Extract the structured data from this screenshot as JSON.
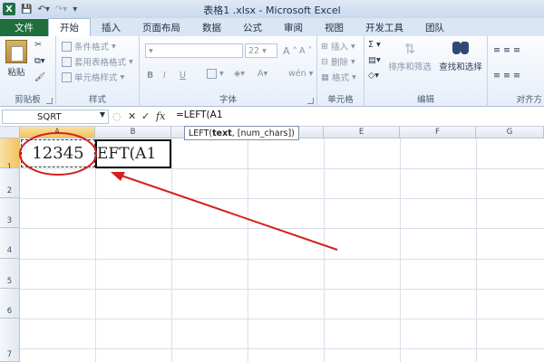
{
  "window": {
    "title": "表格1 .xlsx - Microsoft Excel",
    "app_icon": "X"
  },
  "tabs": [
    "文件",
    "开始",
    "插入",
    "页面布局",
    "数据",
    "公式",
    "审阅",
    "视图",
    "开发工具",
    "团队"
  ],
  "ribbon": {
    "clipboard": {
      "paste": "粘贴",
      "label": "剪贴板"
    },
    "styles": {
      "cond_format": "条件格式",
      "table_format": "套用表格格式",
      "cell_styles": "单元格样式",
      "label": "样式"
    },
    "font": {
      "size": "22",
      "bold": "B",
      "italic": "I",
      "underline": "U",
      "grow": "A",
      "shrink": "A",
      "wen": "wén",
      "label": "字体"
    },
    "cells": {
      "insert": "插入",
      "delete": "删除",
      "format": "格式",
      "label": "单元格"
    },
    "editing": {
      "sigma": "Σ",
      "sort_filter": "排序和筛选",
      "find_select": "查找和选择",
      "label": "编辑"
    },
    "align": {
      "label": "对齐方"
    }
  },
  "formula_bar": {
    "name_box": "SQRT",
    "cancel": "✕",
    "enter": "✓",
    "fx": "fx",
    "formula": "=LEFT(A1"
  },
  "tooltip": {
    "func": "LEFT(",
    "arg1": "text",
    "rest": ", [num_chars])"
  },
  "grid": {
    "columns": [
      "A",
      "B",
      "C",
      "D",
      "E",
      "F",
      "G"
    ],
    "rows": [
      "1",
      "2",
      "3",
      "4",
      "5",
      "6",
      "7"
    ],
    "A1": "12345",
    "B1": "EFT(A1"
  },
  "colors": {
    "file_tab": "#1f6e3e",
    "annotation": "#d42020",
    "selected_header": "#f1c45e"
  }
}
